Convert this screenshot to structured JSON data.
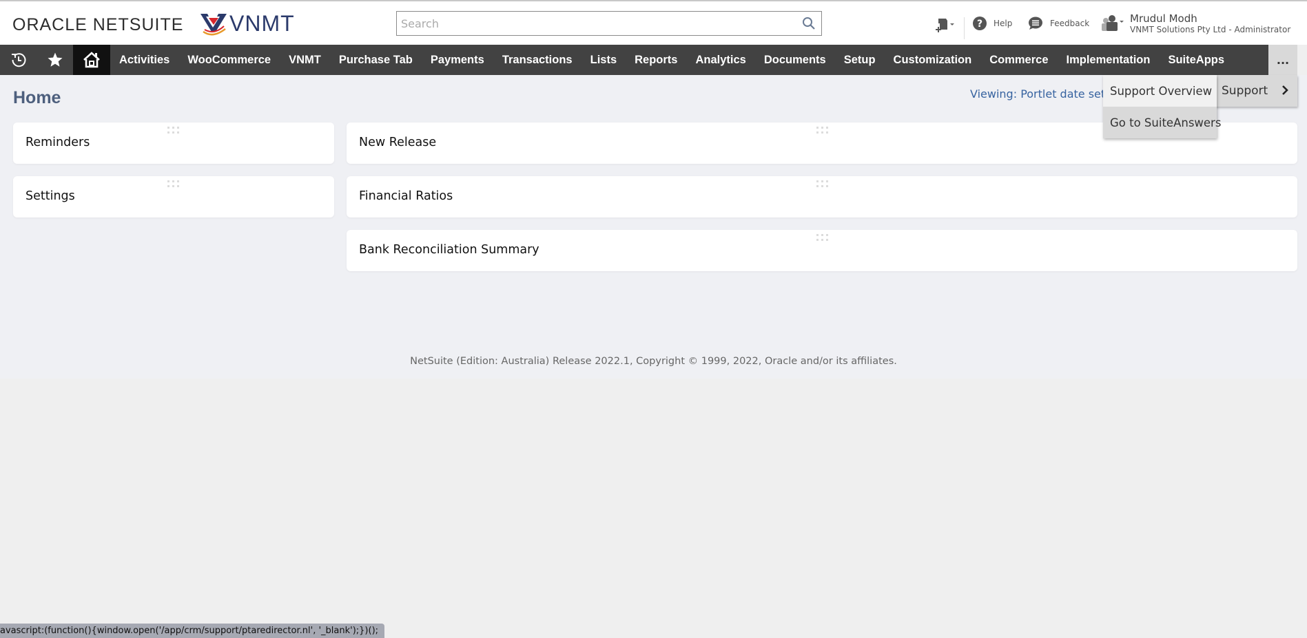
{
  "header": {
    "oracle_logo_bold": "ORACLE NET",
    "oracle_logo_light": "SUITE",
    "company_logo_text": "VNMT",
    "search": {
      "placeholder": "Search",
      "value": ""
    },
    "help_label": "Help",
    "feedback_label": "Feedback",
    "user": {
      "name": "Mrudul Modh",
      "role": "VNMT Solutions Pty Ltd - Administrator"
    }
  },
  "nav": {
    "icons": [
      "recent-records-icon",
      "star-icon",
      "home-icon"
    ],
    "items": [
      {
        "label": "Activities"
      },
      {
        "label": "WooCommerce"
      },
      {
        "label": "VNMT"
      },
      {
        "label": "Purchase Tab"
      },
      {
        "label": "Payments"
      },
      {
        "label": "Transactions"
      },
      {
        "label": "Lists"
      },
      {
        "label": "Reports"
      },
      {
        "label": "Analytics"
      },
      {
        "label": "Documents"
      },
      {
        "label": "Setup"
      },
      {
        "label": "Customization"
      },
      {
        "label": "Commerce"
      },
      {
        "label": "Implementation"
      },
      {
        "label": "SuiteApps"
      }
    ],
    "more_label": "..."
  },
  "dropdown": {
    "parent_label": "Support",
    "submenu": [
      {
        "label": "Support Overview",
        "highlighted": true
      },
      {
        "label": "Go to SuiteAnswers",
        "highlighted": false
      }
    ]
  },
  "page": {
    "title": "Home",
    "viewing_text": "Viewing: Portlet date settin",
    "left_portlets": [
      {
        "title": "Reminders"
      },
      {
        "title": "Settings"
      }
    ],
    "right_portlets": [
      {
        "title": "New Release"
      },
      {
        "title": "Financial Ratios"
      },
      {
        "title": "Bank Reconciliation Summary"
      }
    ],
    "footer": "NetSuite (Edition: Australia) Release 2022.1, Copyright © 1999, 2022, Oracle and/or its affiliates."
  },
  "statusbar": {
    "text": "avascript:(function(){window.open('/app/crm/support/ptaredirector.nl', '_blank');})();"
  },
  "colors": {
    "nav_bg": "#424242",
    "nav_home_bg": "#111111",
    "page_bg": "#eff0f4",
    "title_color": "#4d5f7d",
    "link_color": "#3763a0",
    "menu_bg": "#d9d9d9"
  }
}
